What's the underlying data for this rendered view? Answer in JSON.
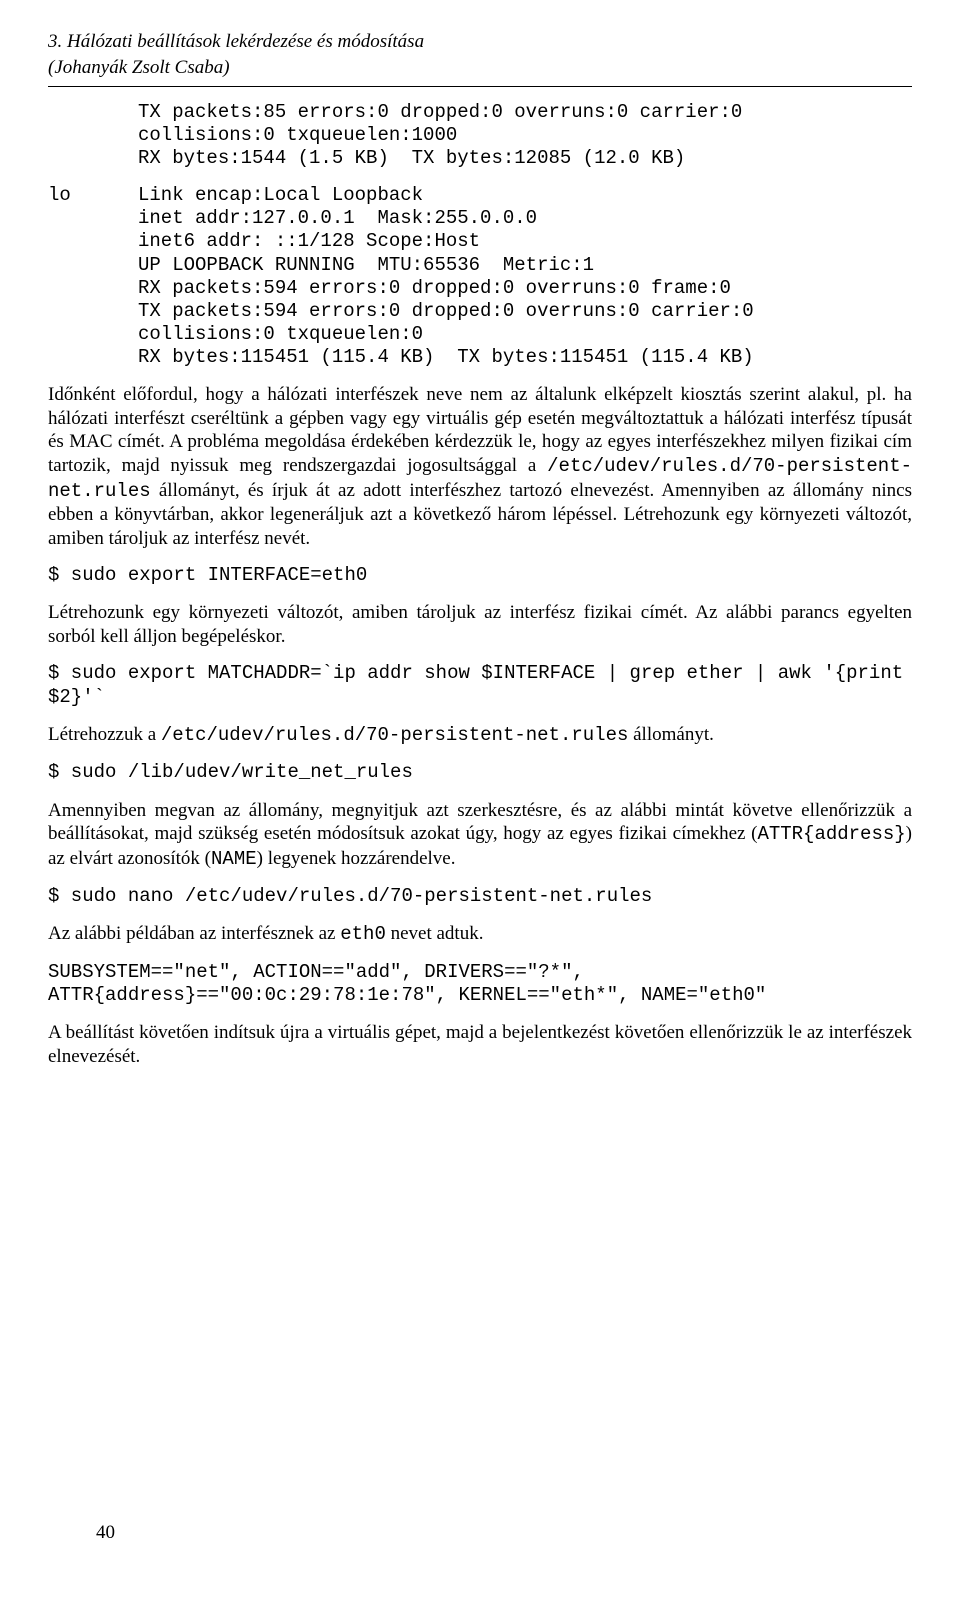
{
  "header": {
    "title": "3. Hálózati beállítások lekérdezése és módosítása",
    "author": "(Johanyák Zsolt Csaba)"
  },
  "code_block_1": "TX packets:85 errors:0 dropped:0 overruns:0 carrier:0\ncollisions:0 txqueuelen:1000\nRX bytes:1544 (1.5 KB)  TX bytes:12085 (12.0 KB)",
  "lo_label": "lo",
  "code_block_lo": "Link encap:Local Loopback\ninet addr:127.0.0.1  Mask:255.0.0.0\ninet6 addr: ::1/128 Scope:Host\nUP LOOPBACK RUNNING  MTU:65536  Metric:1\nRX packets:594 errors:0 dropped:0 overruns:0 frame:0\nTX packets:594 errors:0 dropped:0 overruns:0 carrier:0\ncollisions:0 txqueuelen:0\nRX bytes:115451 (115.4 KB)  TX bytes:115451 (115.4 KB)",
  "para1_a": "Időnként előfordul, hogy a hálózati interfészek neve nem az általunk elképzelt kiosztás szerint alakul, pl. ha hálózati interfészt cseréltünk a gépben vagy egy virtuális gép esetén megváltoztattuk a hálózati interfész típusát és MAC címét. A probléma megoldása érdekében kérdezzük le, hogy az egyes interfészekhez milyen fizikai cím tartozik, majd nyissuk meg rendszergazdai jogosultsággal a ",
  "para1_code": "/etc/udev/rules.d/70-persistent-net.rules",
  "para1_b": " állományt, és írjuk át az adott interfészhez tartozó elnevezést. Amennyiben az állomány nincs ebben a könyvtárban, akkor legeneráljuk azt a következő három lépéssel. Létrehozunk egy környezeti változót, amiben tároljuk az interfész nevét.",
  "cmd1": "$ sudo export INTERFACE=eth0",
  "para2": "Létrehozunk egy környezeti változót, amiben tároljuk az interfész fizikai címét. Az alábbi parancs egyelten sorból kell álljon begépeléskor.",
  "cmd2": "$ sudo export MATCHADDR=`ip addr show $INTERFACE | grep ether | awk '{print $2}'`",
  "para3_a": "Létrehozzuk a ",
  "para3_code": "/etc/udev/rules.d/70-persistent-net.rules",
  "para3_b": " állományt.",
  "cmd3": "$ sudo /lib/udev/write_net_rules",
  "para4_a": "Amennyiben megvan az állomány, megnyitjuk azt szerkesztésre, és az alábbi mintát követve ellenőrizzük a beállításokat, majd szükség esetén módosítsuk azokat úgy, hogy az egyes fizikai címekhez (",
  "para4_code1": "ATTR{address}",
  "para4_b": ") az elvárt azonosítók (",
  "para4_code2": "NAME",
  "para4_c": ") legyenek hozzárendelve.",
  "cmd4": "$ sudo nano /etc/udev/rules.d/70-persistent-net.rules",
  "para5_a": "Az alábbi példában az interfésznek az ",
  "para5_code": "eth0",
  "para5_b": " nevet adtuk.",
  "cmd5": "SUBSYSTEM==\"net\", ACTION==\"add\", DRIVERS==\"?*\", ATTR{address}==\"00:0c:29:78:1e:78\", KERNEL==\"eth*\", NAME=\"eth0\"",
  "para6": "A beállítást követően indítsuk újra a virtuális gépet, majd a bejelentkezést követően ellenőrizzük le az interfészek elnevezését.",
  "page_number": "40"
}
